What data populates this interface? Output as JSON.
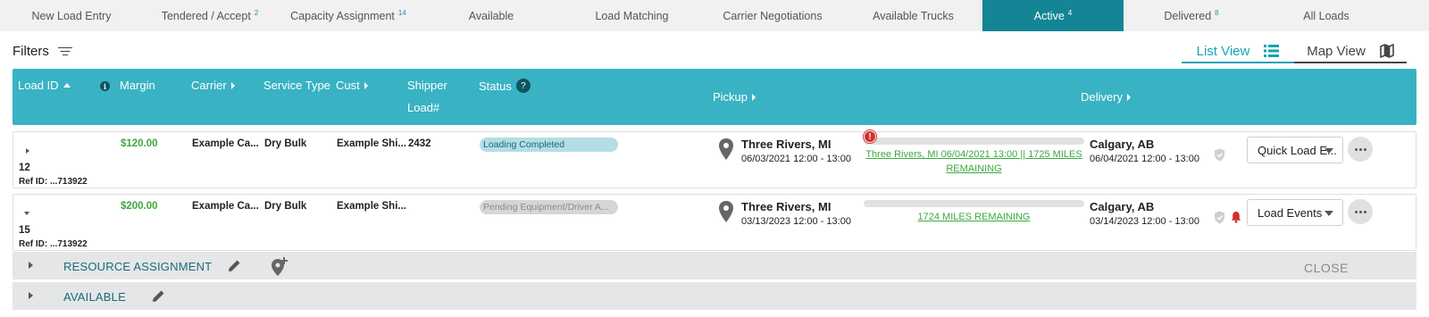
{
  "tabs": [
    {
      "label": "New Load Entry",
      "badge": ""
    },
    {
      "label": "Tendered / Accept",
      "badge": "2"
    },
    {
      "label": "Capacity Assignment",
      "badge": "14"
    },
    {
      "label": "Available",
      "badge": ""
    },
    {
      "label": "Load Matching",
      "badge": ""
    },
    {
      "label": "Carrier Negotiations",
      "badge": ""
    },
    {
      "label": "Available Trucks",
      "badge": ""
    },
    {
      "label": "Active",
      "badge": "4",
      "active": true
    },
    {
      "label": "Delivered",
      "badge": "8"
    },
    {
      "label": "All Loads",
      "badge": ""
    }
  ],
  "filters": {
    "label": "Filters",
    "icon": "filter-icon"
  },
  "views": {
    "list_label": "List View",
    "map_label": "Map View",
    "selected": "List View"
  },
  "columns": {
    "load_id": "Load ID",
    "margin": "Margin",
    "carrier": "Carrier",
    "service_type": "Service Type",
    "cust": "Cust",
    "shipper_line1": "Shipper",
    "shipper_line2": "Load#",
    "status": "Status",
    "status_help": "?",
    "pickup": "Pickup",
    "delivery": "Delivery"
  },
  "rows": [
    {
      "load_id": "12",
      "ref_id": "Ref ID: ...713922",
      "margin": "$120.00",
      "carrier": "Example Ca...",
      "service_type": "Dry Bulk",
      "cust": "Example Shi...",
      "shipper_load": "2432",
      "status": "Loading Completed",
      "pickup_city": "Three Rivers, MI",
      "pickup_dt": "06/03/2021 12:00 - 13:00",
      "progress": 0,
      "alert": "!",
      "route_line1": "Three Rivers, MI 06/04/2021 13:00 || 1725 MILES",
      "route_line2": "REMAINING",
      "delivery_city": "Calgary, AB",
      "delivery_dt": "06/04/2021 12:00 - 13:00",
      "action": "Quick Load E..."
    },
    {
      "load_id": "15",
      "ref_id": "Ref ID: ...713922",
      "margin": "$200.00",
      "carrier": "Example Ca...",
      "service_type": "Dry Bulk",
      "cust": "Example Shi...",
      "shipper_load": "",
      "status": "Pending Equipment/Driver A...",
      "pickup_city": "Three Rivers, MI",
      "pickup_dt": "03/13/2023 12:00 - 13:00",
      "progress": 0,
      "route_line1": "1724 MILES REMAINING",
      "delivery_city": "Calgary, AB",
      "delivery_dt": "03/14/2023 12:00 - 13:00",
      "action": "Load Events"
    }
  ],
  "subrows": {
    "resource_assignment": "RESOURCE ASSIGNMENT",
    "available": "AVAILABLE",
    "close": "CLOSE"
  },
  "colors": {
    "active_tab": "#138595",
    "header": "#39b2c3",
    "margin": "#3ea83e",
    "status_teal": "#b5dde6",
    "alert": "#d32f2f"
  }
}
